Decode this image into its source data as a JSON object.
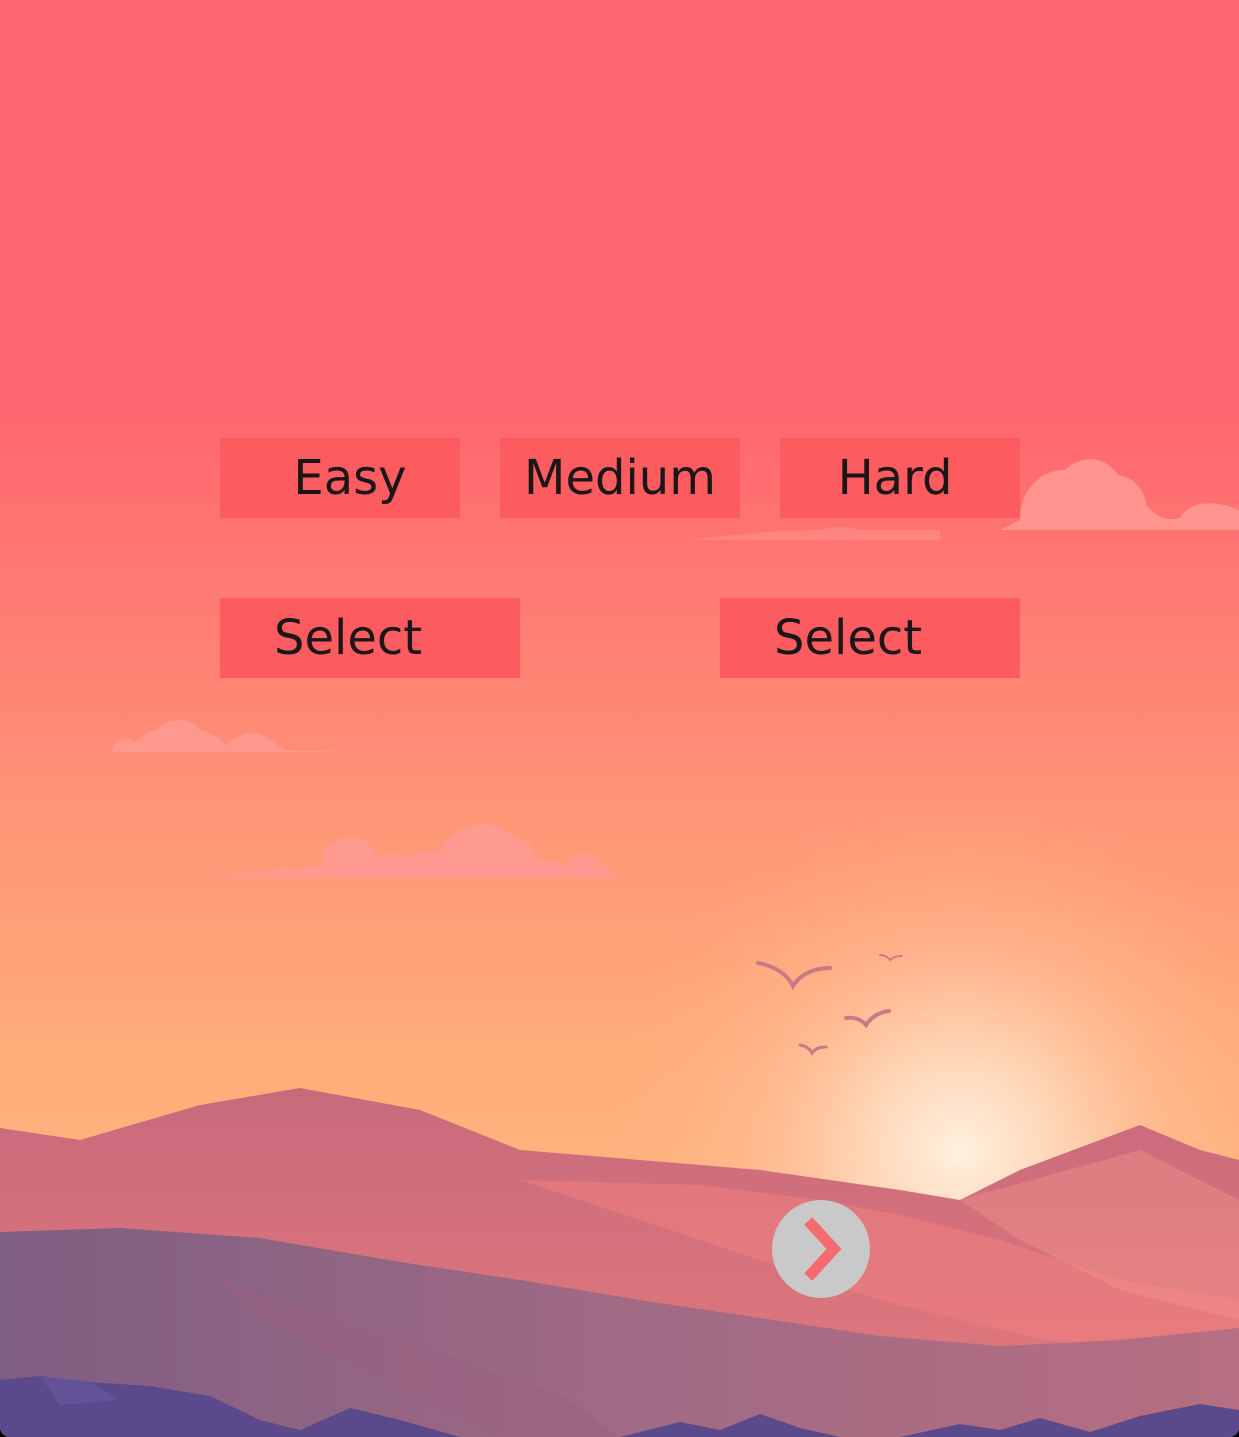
{
  "difficulty": {
    "easy_label": "Easy",
    "medium_label": "Medium",
    "hard_label": "Hard"
  },
  "selectors": {
    "left_label": "Select",
    "right_label": "Select"
  },
  "next": {
    "icon": "chevron-right-icon"
  },
  "colors": {
    "button_bg": "#fc5c5f",
    "button_text": "#1b1618",
    "next_button_bg": "#c9c9c9",
    "next_chevron": "#f46b72"
  }
}
